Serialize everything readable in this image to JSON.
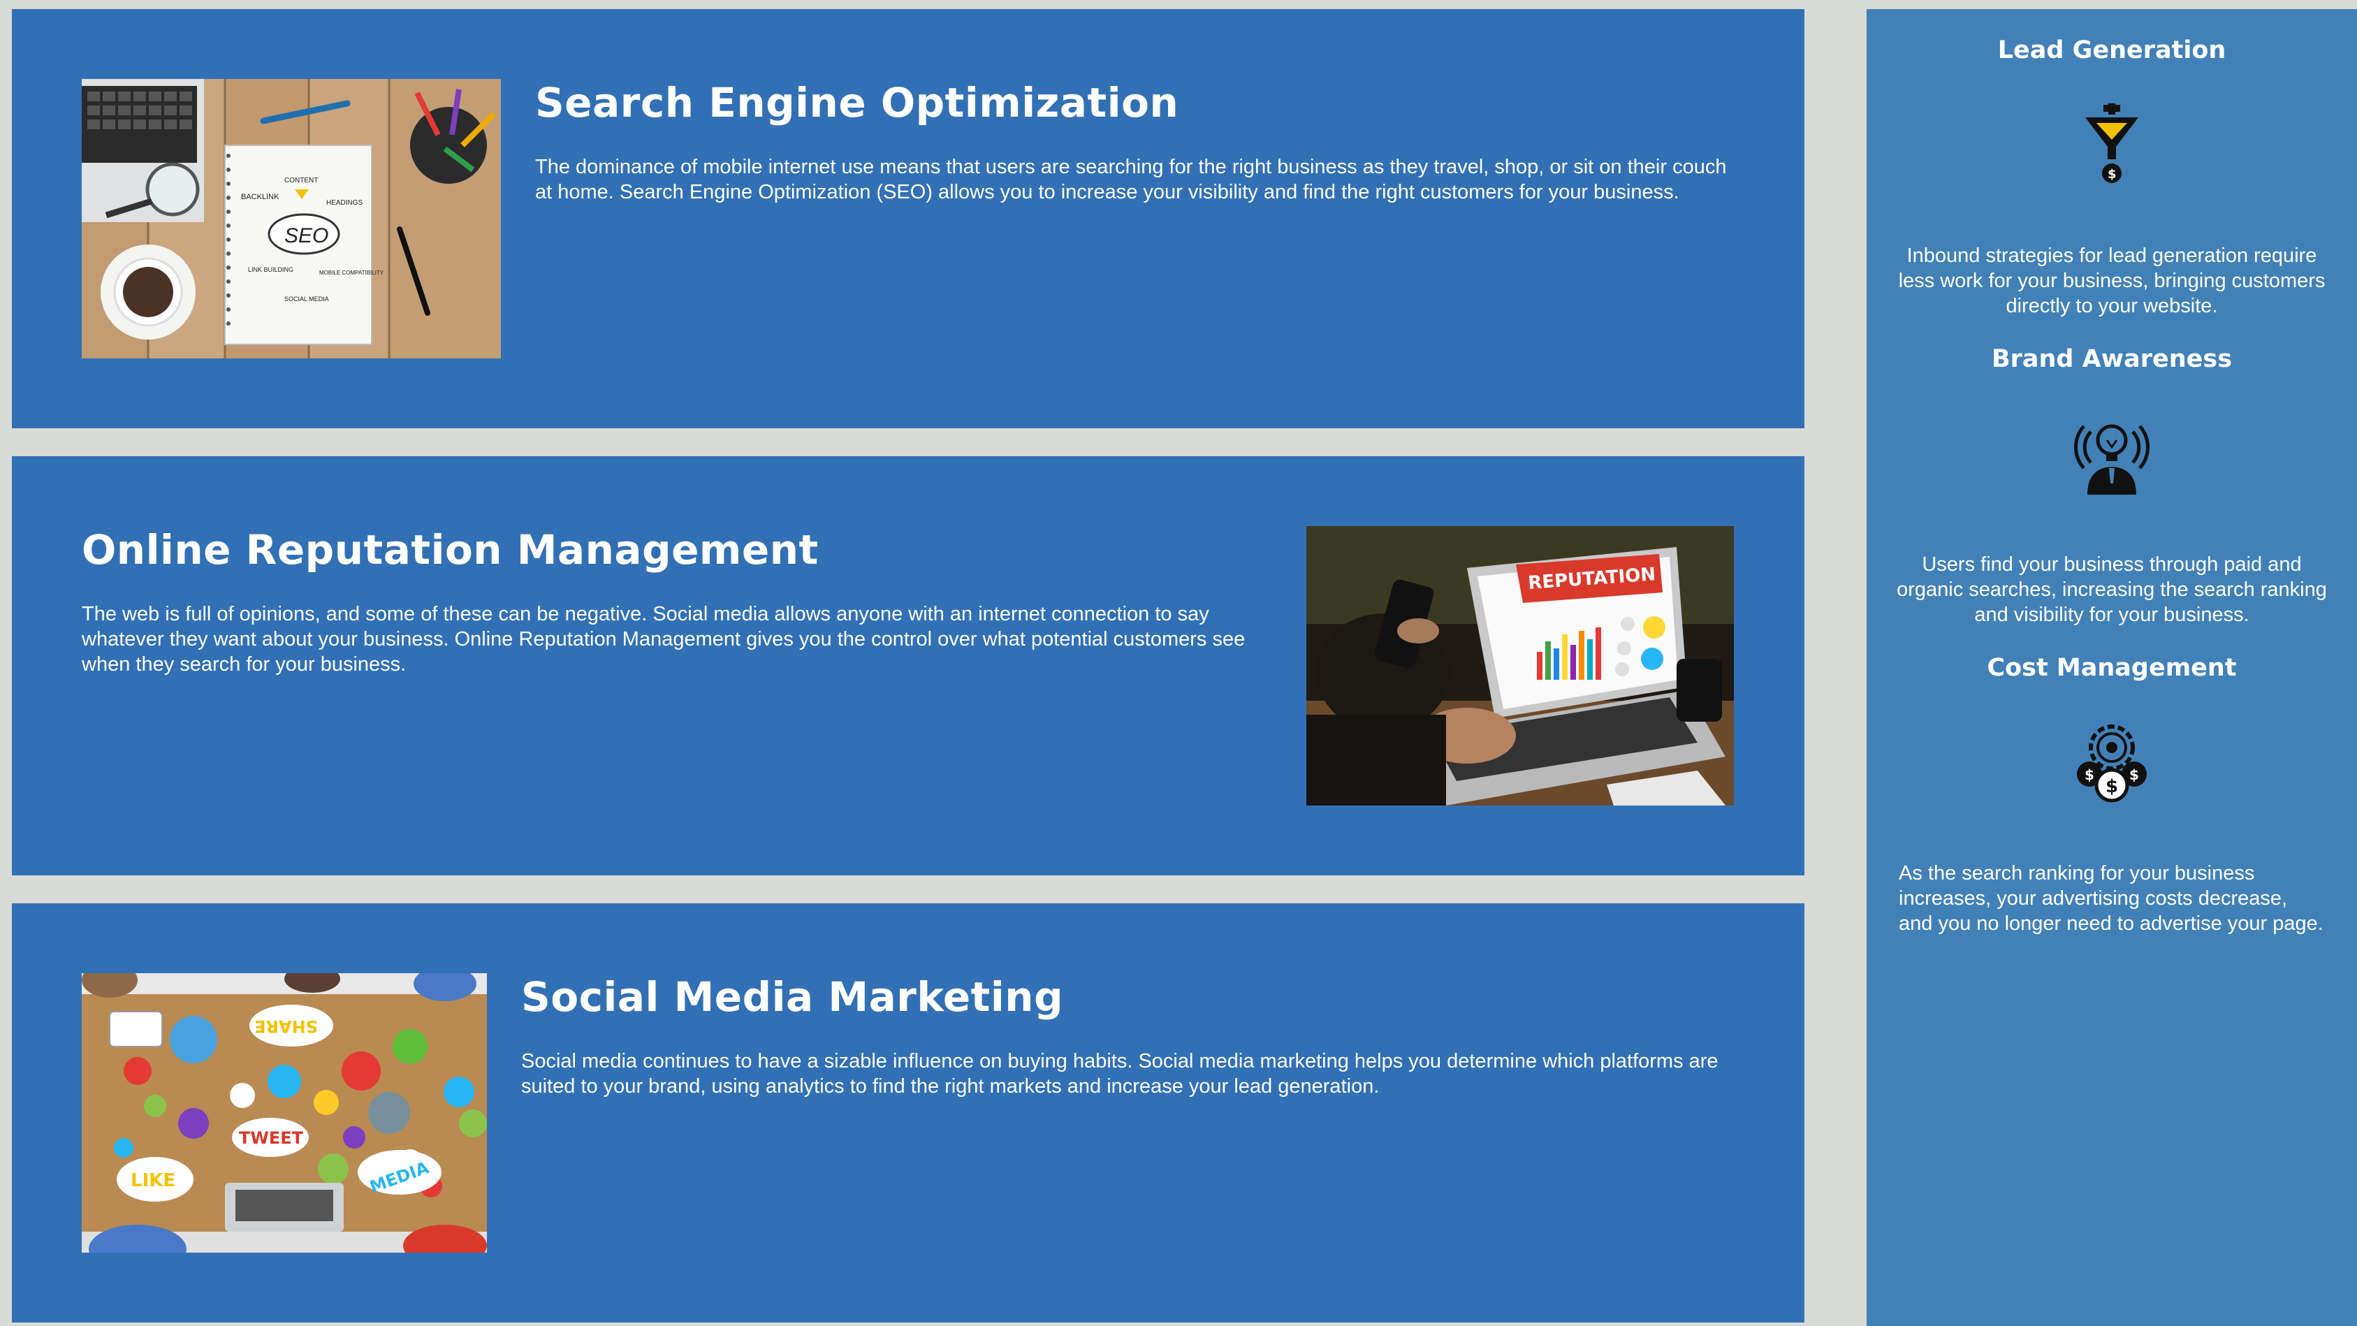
{
  "content": {
    "cards": [
      {
        "title": "Search Engine Optimization",
        "body": "The dominance of mobile internet use means that users are searching for the right business as they travel, shop, or sit on their couch at home. Search Engine Optimization (SEO) allows you to increase your visibility and find the right customers for your business.",
        "image": {
          "labels": [
            "CONTENT",
            "BACKLINK",
            "HEADINGS",
            "SEO",
            "LINK BUILDING",
            "MOBILE COMPATIBILITY",
            "SOCIAL MEDIA"
          ]
        }
      },
      {
        "title": "Online Reputation Management",
        "body": "The web is full of opinions, and some of these can be negative. Social media allows anyone with an internet connection to say whatever they want about your business. Online Reputation Management gives you the control over what potential customers see when they search for your business.",
        "image": {
          "labels": [
            "REPUTATION"
          ]
        }
      },
      {
        "title": "Social Media Marketing",
        "body": "Social media continues to have a sizable influence on buying habits. Social media marketing helps you determine which platforms are suited to your brand, using analytics to find the right markets and increase your lead generation.",
        "image": {
          "labels": [
            "SHARE",
            "TWEET",
            "LIKE",
            "MEDIA"
          ]
        }
      }
    ]
  },
  "sidebar": {
    "benefits": [
      {
        "title": "Lead Generation",
        "icon": "funnel-dollar-icon",
        "body": "Inbound strategies for lead generation require less work for your business, bringing customers directly to your website."
      },
      {
        "title": "Brand Awareness",
        "icon": "lightbulb-head-icon",
        "body": "Users find your business through paid and organic searches, increasing the search ranking and visibility for your business."
      },
      {
        "title": "Cost Management",
        "icon": "gear-coins-icon",
        "body": "As the search ranking for your business increases, your advertising costs decrease, and you no longer need to advertise your page."
      }
    ]
  },
  "colors": {
    "page_background": "#d9dbd6",
    "card_background": "#3270b6",
    "sidebar_background": "#4281b8",
    "text": "#ffffff"
  }
}
